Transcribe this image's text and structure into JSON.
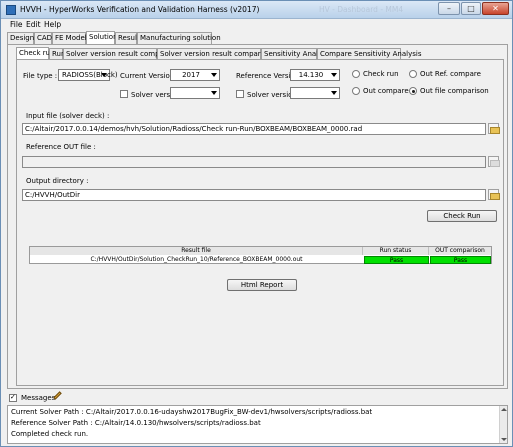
{
  "window": {
    "title": "HVVH - HyperWorks Verification and Validation Harness (v2017)",
    "ghost_title": "HV - Dashboard - MM4",
    "min": "–",
    "max": "□",
    "close": "✕"
  },
  "menu": [
    "File",
    "Edit",
    "Help"
  ],
  "main_tabs": [
    "Design",
    "CAD",
    "FE Model",
    "Solution",
    "Result",
    "Manufacturing solution"
  ],
  "sub_tabs": [
    "Check run",
    "Run",
    "Solver version result comparison",
    "Solver version result comparison HG",
    "Sensitivity Analysis",
    "Compare Sensitivity Analysis"
  ],
  "form": {
    "file_type_label": "File type :",
    "file_type_value": "RADIOSS(Block)",
    "current_version_label": "Current Version :",
    "current_version_value": "2017",
    "reference_version_label": "Reference Version :",
    "reference_version_value": "14.130",
    "solver_version_label_1": "Solver version:",
    "solver_version_label_2": "Solver version:",
    "radio_check_run": "Check run",
    "radio_out_ref_compare": "Out Ref. compare",
    "radio_out_compare": "Out compare",
    "radio_out_file_comparison": "Out file comparison",
    "input_file_label": "Input file (solver deck) :",
    "input_file_value": "C:/Altair/2017.0.0.14/demos/hvh/Solution/Radioss/Check run-Run/BOXBEAM/BOXBEAM_0000.rad",
    "reference_out_label": "Reference OUT file :",
    "reference_out_value": "",
    "output_dir_label": "Output directory :",
    "output_dir_value": "C:/HVVH/OutDir",
    "check_run_button": "Check Run",
    "html_report_button": "Html Report"
  },
  "results_table": {
    "headers": [
      "Result file",
      "Run status",
      "OUT comparison"
    ],
    "rows": [
      [
        "C:/HVVH/OutDir/Solution_CheckRun_10/Reference_BOXBEAM_0000.out",
        "Pass",
        "Pass"
      ]
    ]
  },
  "messages": {
    "label": "Messages",
    "lines": [
      "Current Solver Path : C:/Altair/2017.0.0.16-udayshw2017BugFix_BW-dev1/hwsolvers/scripts/radioss.bat",
      "Reference Solver Path : C:/Altair/14.0.130/hwsolvers/scripts/radioss.bat",
      "Completed check run."
    ]
  },
  "colors": {
    "pass": "#00e000",
    "titlebar": "#c8daee"
  }
}
